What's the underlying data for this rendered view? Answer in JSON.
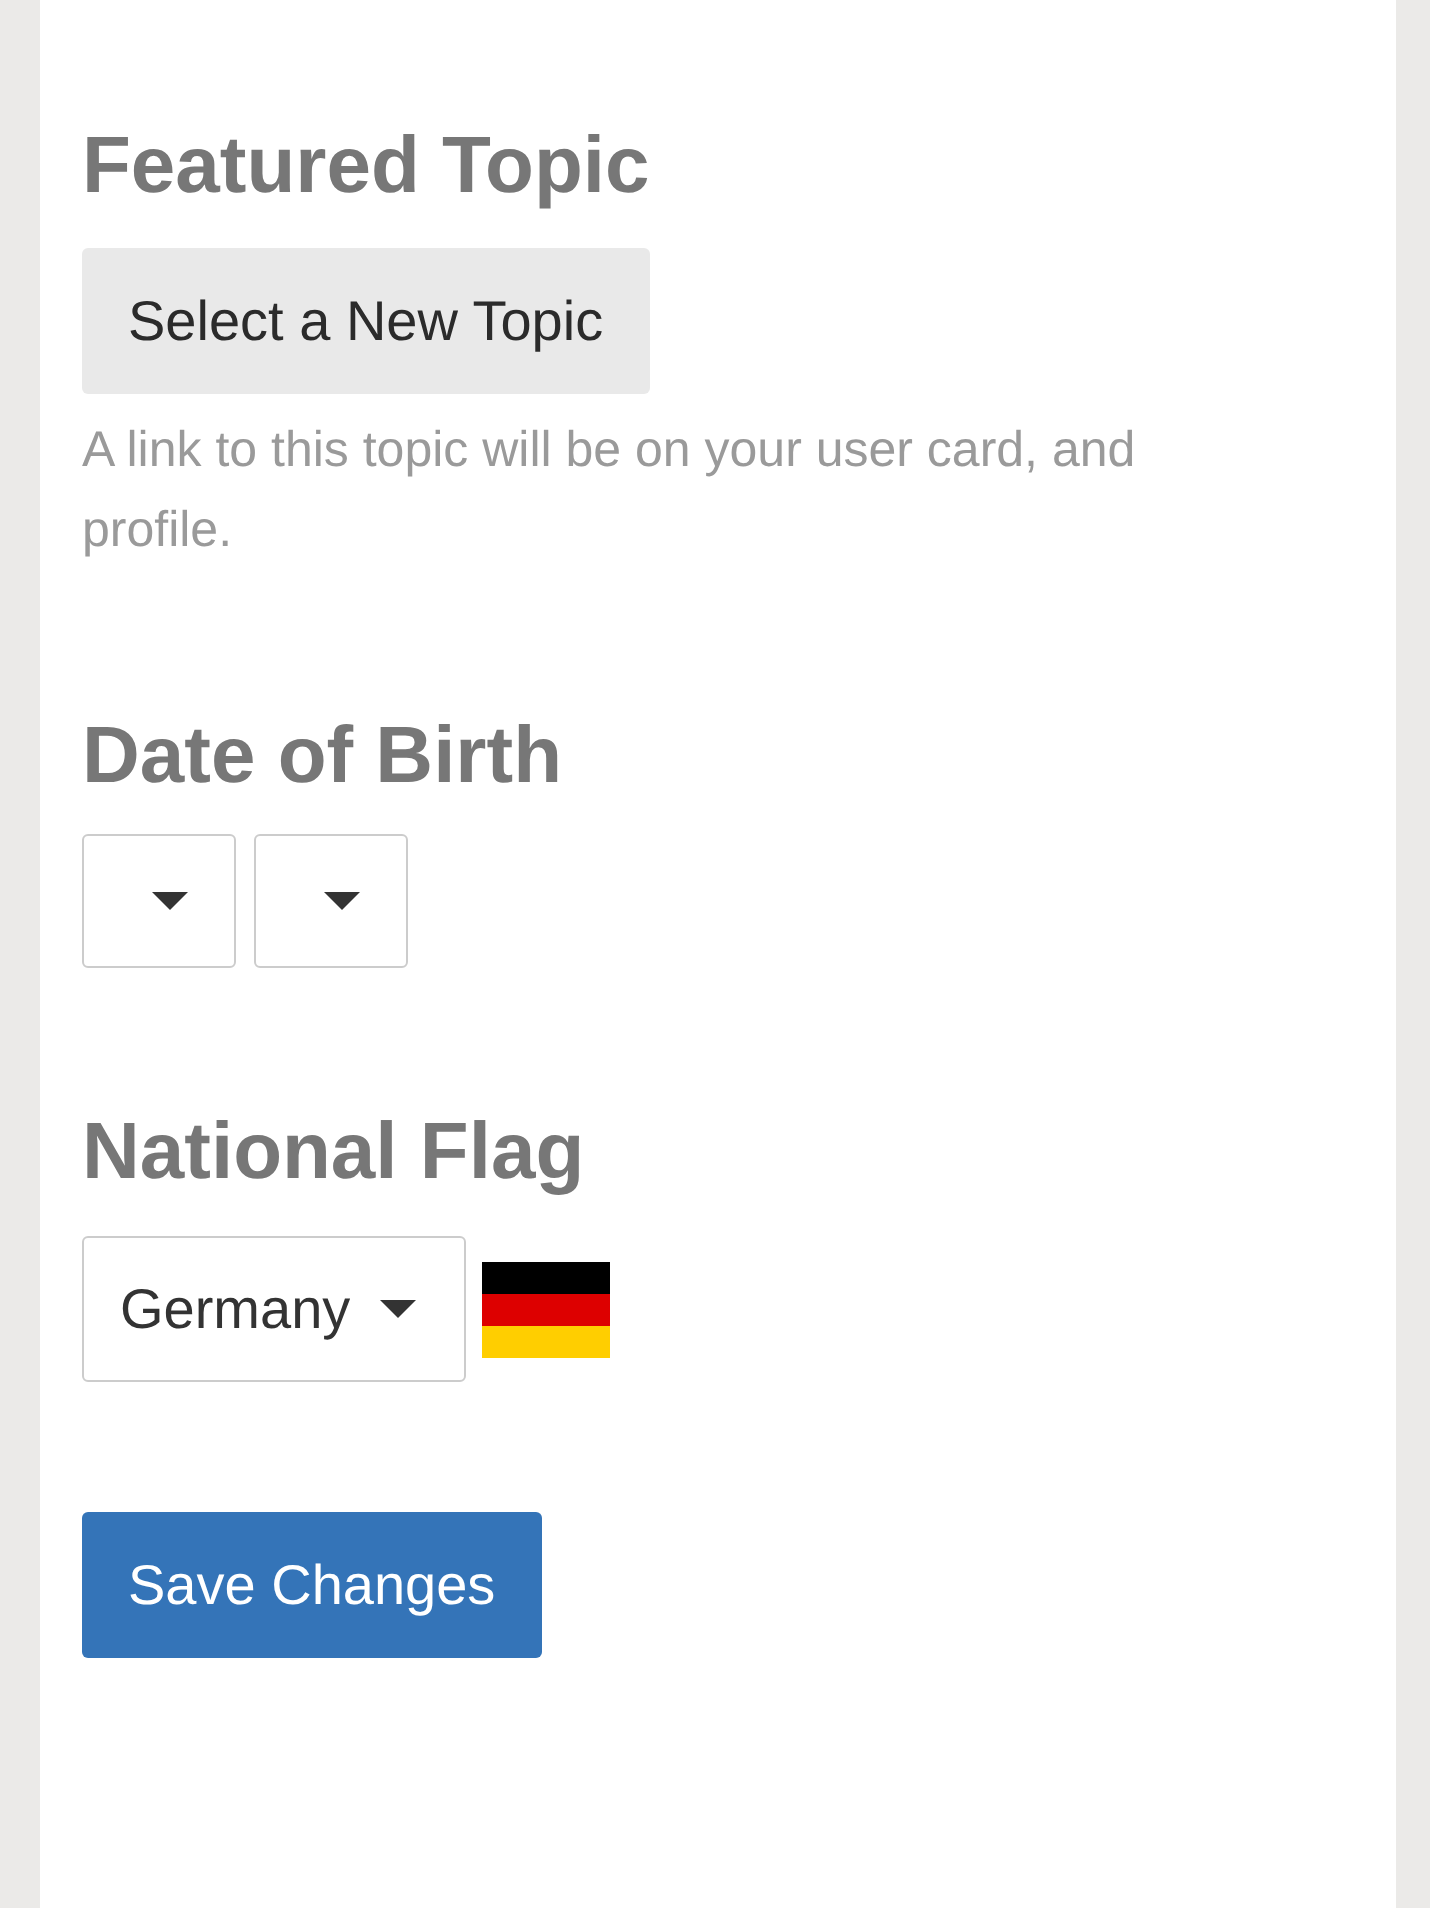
{
  "featured_topic": {
    "heading": "Featured Topic",
    "button": "Select a New Topic",
    "help": "A link to this topic will be on your user card, and profile."
  },
  "date_of_birth": {
    "heading": "Date of Birth",
    "dropdowns": [
      {
        "expanded": false
      },
      {
        "expanded": false
      }
    ]
  },
  "national_flag": {
    "heading": "National Flag",
    "dropdown": {
      "value": "Germany",
      "expanded": false
    }
  },
  "save_button": "Save Changes"
}
